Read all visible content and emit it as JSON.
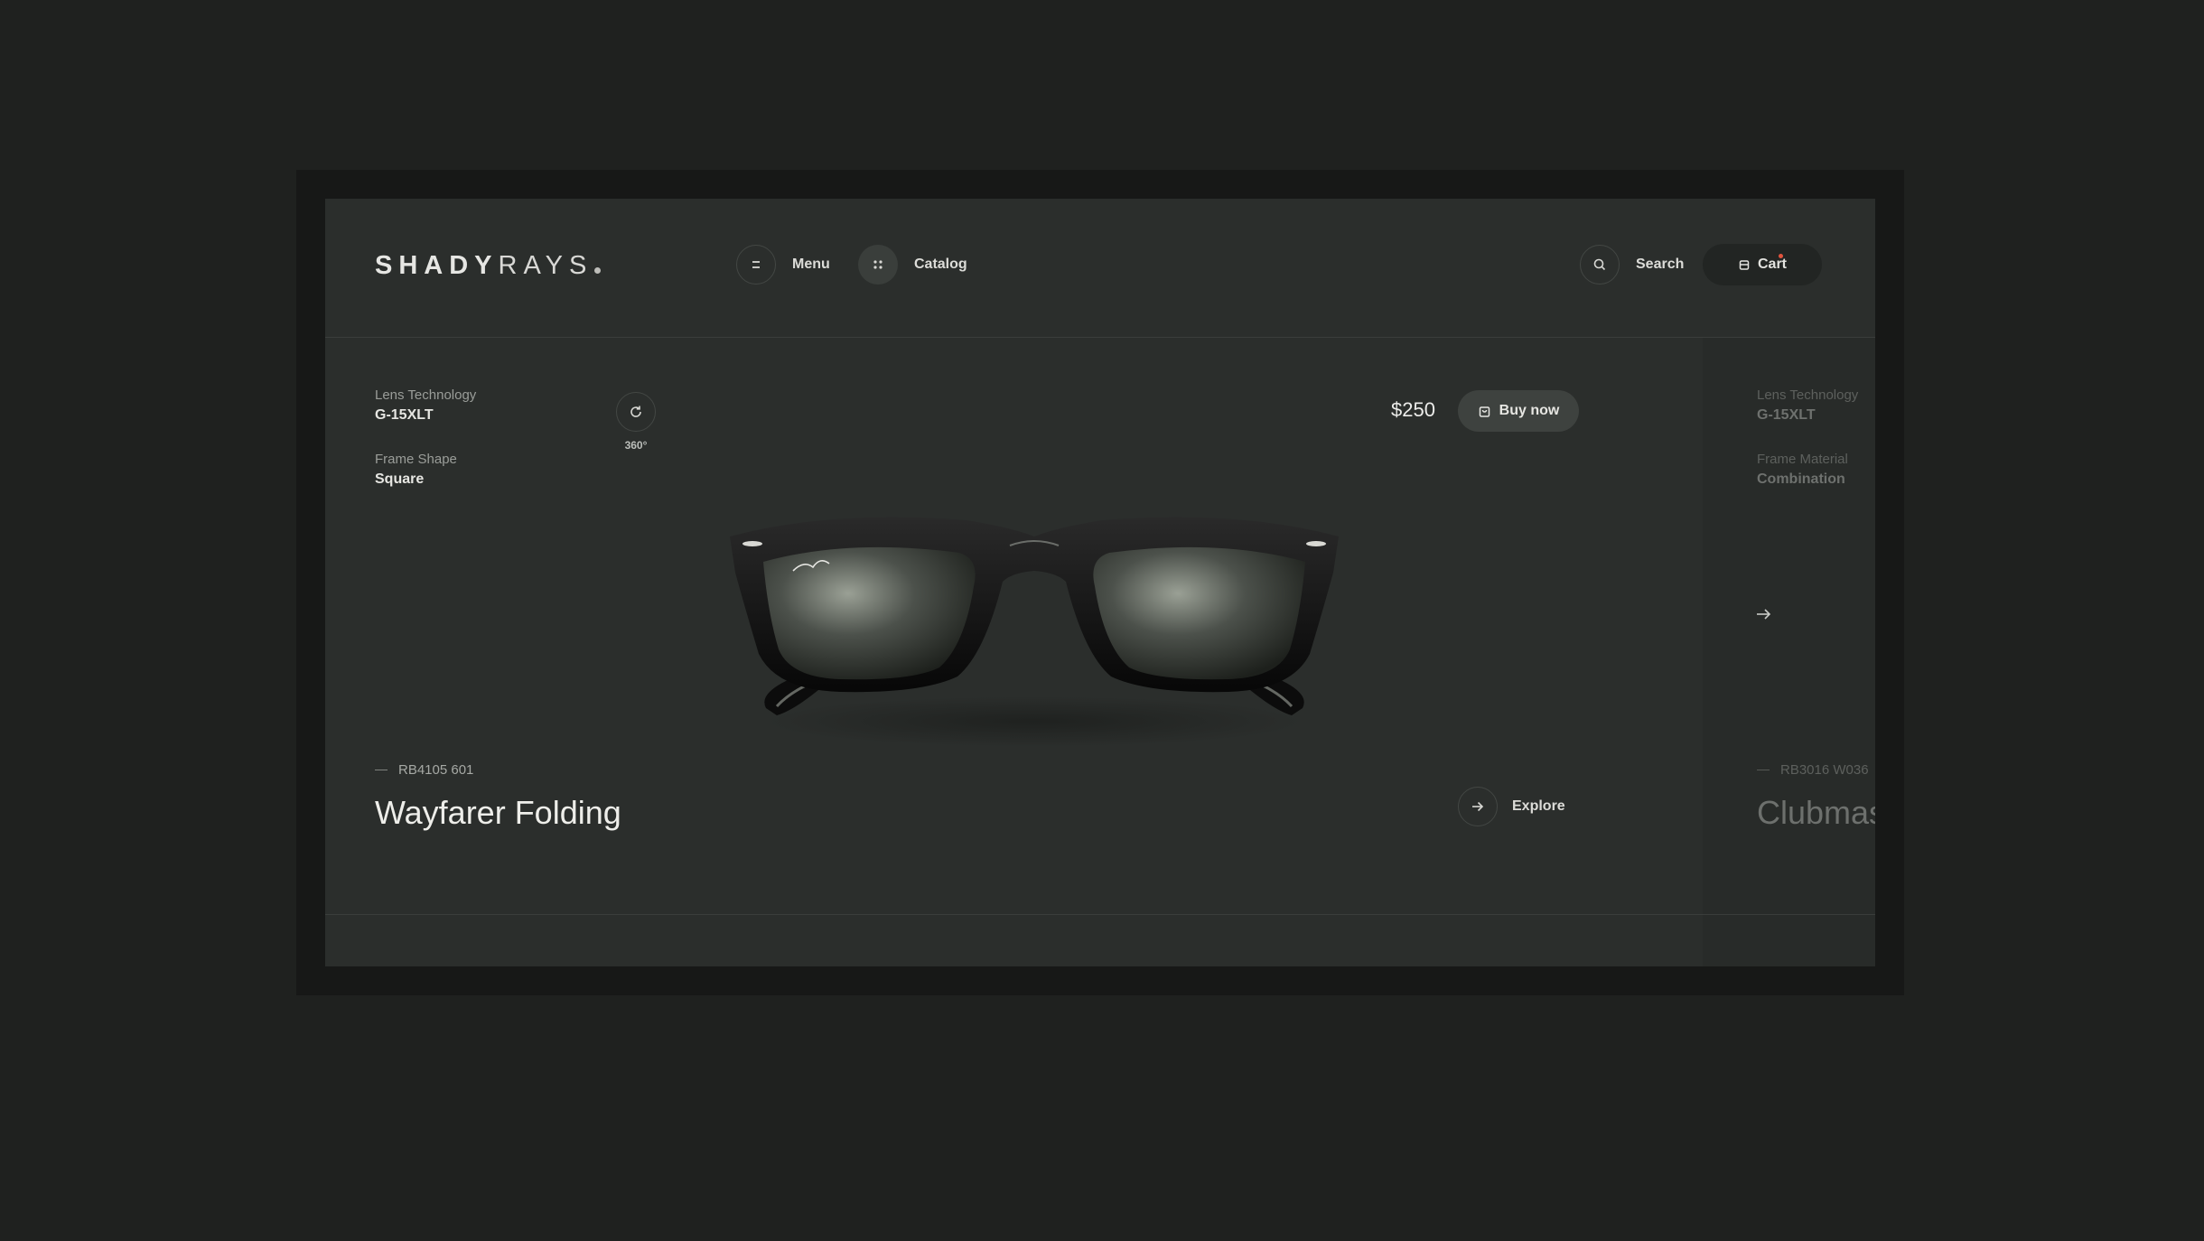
{
  "brand": {
    "bold": "SHADY",
    "light": "RAYS"
  },
  "nav": {
    "menu_label": "Menu",
    "catalog_label": "Catalog",
    "search_label": "Search",
    "cart_label": "Cart"
  },
  "product": {
    "specs": [
      {
        "label": "Lens Technology",
        "value": "G-15XLT"
      },
      {
        "label": "Frame Shape",
        "value": "Square"
      }
    ],
    "rotate_label": "360°",
    "price": "$250",
    "buy_label": "Buy now",
    "model": "RB4105 601",
    "name": "Wayfarer Folding",
    "explore_label": "Explore"
  },
  "next_product": {
    "specs": [
      {
        "label": "Lens Technology",
        "value": "G-15XLT"
      },
      {
        "label": "Frame Material",
        "value": "Combination"
      }
    ],
    "model": "RB3016 W036",
    "name": "Clubmaster"
  },
  "colors": {
    "background": "#1f211f",
    "screen": "#2b2e2c",
    "accent_dot": "#e0533d"
  }
}
